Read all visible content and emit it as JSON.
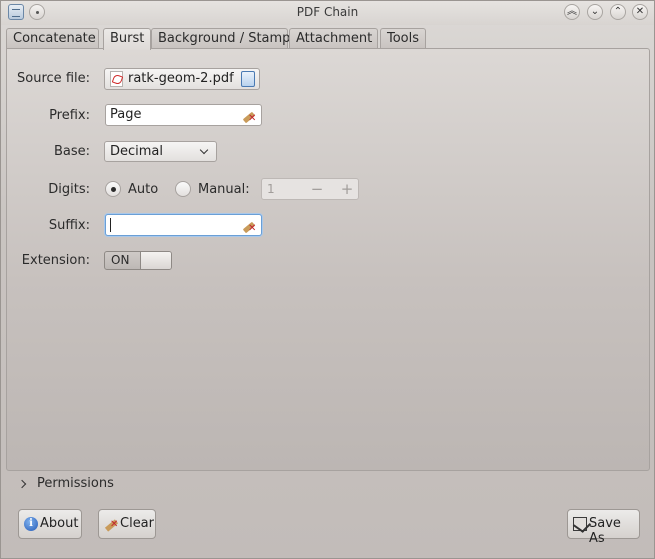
{
  "window": {
    "title": "PDF Chain"
  },
  "tabs": [
    {
      "label": "Concatenate",
      "active": false
    },
    {
      "label": "Burst",
      "active": true
    },
    {
      "label": "Background / Stamp",
      "active": false
    },
    {
      "label": "Attachment",
      "active": false
    },
    {
      "label": "Tools",
      "active": false
    }
  ],
  "form": {
    "source_file_label": "Source file:",
    "source_file_name": "ratk-geom-2.pdf",
    "prefix_label": "Prefix:",
    "prefix_value": "Page",
    "base_label": "Base:",
    "base_value": "Decimal",
    "digits_label": "Digits:",
    "digits_auto_label": "Auto",
    "digits_manual_label": "Manual:",
    "digits_selected": "Auto",
    "digits_manual_value": "1",
    "suffix_label": "Suffix:",
    "suffix_value": "",
    "extension_label": "Extension:",
    "extension_state": "ON"
  },
  "permissions": {
    "label": "Permissions"
  },
  "buttons": {
    "about": "About",
    "clear": "Clear",
    "save_as": "Save As"
  },
  "icons": {
    "about": "info-icon",
    "clear": "broom-clear-icon",
    "save_as": "save-icon",
    "source_file": "pdf-file-icon",
    "open_file": "open-file-icon"
  },
  "colors": {
    "focus": "#6a9fd6",
    "pdf_red": "#d02a2a",
    "info_blue": "#2459b5"
  }
}
